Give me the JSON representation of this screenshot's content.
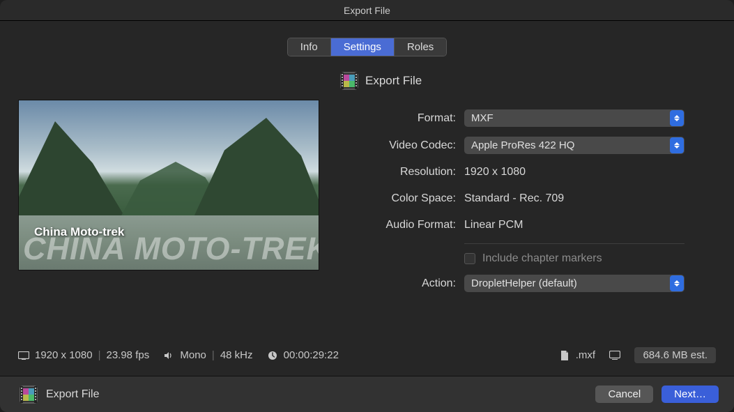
{
  "window": {
    "title": "Export File"
  },
  "tabs": {
    "info": "Info",
    "settings": "Settings",
    "roles": "Roles",
    "active": "settings"
  },
  "panel": {
    "title": "Export File"
  },
  "preview": {
    "overlay_big": "CHINA MOTO-TREK",
    "overlay_small": "China Moto-trek"
  },
  "form": {
    "format_label": "Format:",
    "format_value": "MXF",
    "codec_label": "Video Codec:",
    "codec_value": "Apple ProRes 422 HQ",
    "resolution_label": "Resolution:",
    "resolution_value": "1920 x 1080",
    "colorspace_label": "Color Space:",
    "colorspace_value": "Standard - Rec. 709",
    "audioformat_label": "Audio Format:",
    "audioformat_value": "Linear PCM",
    "chapter_label": "Include chapter markers",
    "action_label": "Action:",
    "action_value": "DropletHelper (default)"
  },
  "status": {
    "dimensions": "1920 x 1080",
    "fps": "23.98 fps",
    "audio_channels": "Mono",
    "audio_rate": "48 kHz",
    "duration": "00:00:29:22",
    "extension": ".mxf",
    "size_estimate": "684.6 MB est."
  },
  "footer": {
    "title": "Export File",
    "cancel": "Cancel",
    "next": "Next…"
  }
}
